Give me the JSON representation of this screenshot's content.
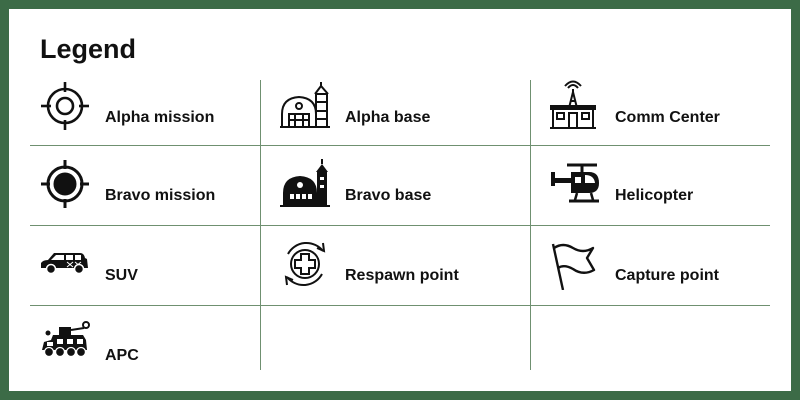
{
  "legend": {
    "title": "Legend",
    "items": [
      {
        "label": "Alpha mission",
        "icon": "crosshair-outline-icon"
      },
      {
        "label": "Alpha base",
        "icon": "hangar-outline-icon"
      },
      {
        "label": "Comm Center",
        "icon": "comm-tower-building-icon"
      },
      {
        "label": "Bravo mission",
        "icon": "crosshair-filled-icon"
      },
      {
        "label": "Bravo base",
        "icon": "hangar-filled-icon"
      },
      {
        "label": "Helicopter",
        "icon": "helicopter-icon"
      },
      {
        "label": "SUV",
        "icon": "suv-icon"
      },
      {
        "label": "Respawn point",
        "icon": "respawn-plus-icon"
      },
      {
        "label": "Capture point",
        "icon": "flag-icon"
      },
      {
        "label": "APC",
        "icon": "apc-icon"
      }
    ]
  },
  "colors": {
    "border": "#3c6b47",
    "grid": "#6f9070",
    "ink": "#111111"
  }
}
